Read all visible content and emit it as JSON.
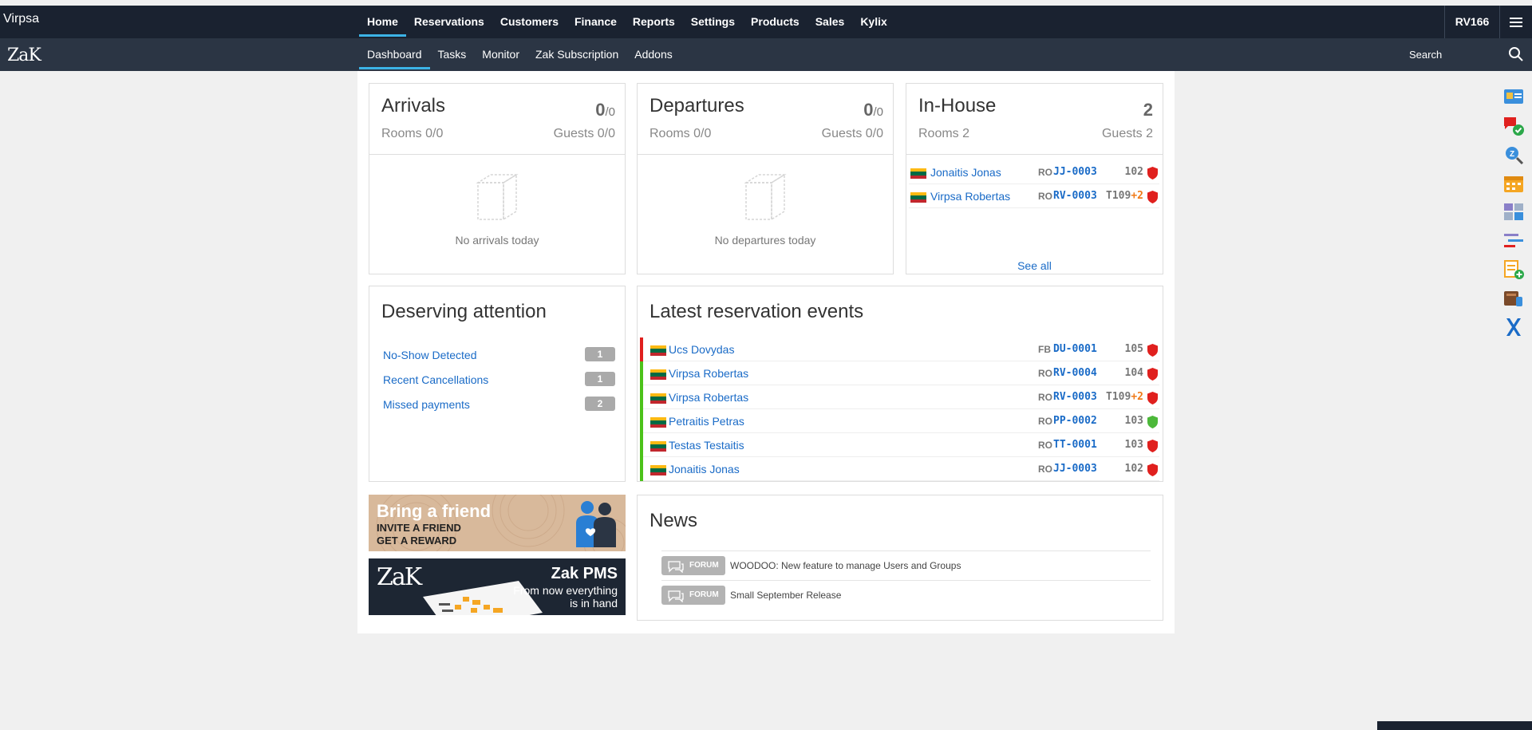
{
  "hotel_name": "Virpsa",
  "logo_text": "ZaK",
  "main_nav": [
    {
      "label": "Home",
      "active": true
    },
    {
      "label": "Reservations"
    },
    {
      "label": "Customers"
    },
    {
      "label": "Finance"
    },
    {
      "label": "Reports"
    },
    {
      "label": "Settings"
    },
    {
      "label": "Products"
    },
    {
      "label": "Sales"
    },
    {
      "label": "Kylix"
    }
  ],
  "sub_nav": [
    {
      "label": "Dashboard",
      "active": true
    },
    {
      "label": "Tasks"
    },
    {
      "label": "Monitor"
    },
    {
      "label": "Zak Subscription"
    },
    {
      "label": "Addons"
    }
  ],
  "user_code": "RV166",
  "search_label": "Search",
  "arrivals": {
    "title": "Arrivals",
    "count": "0",
    "total": "/0",
    "rooms": "Rooms 0/0",
    "guests": "Guests 0/0",
    "empty": "No arrivals today"
  },
  "departures": {
    "title": "Departures",
    "count": "0",
    "total": "/0",
    "rooms": "Rooms 0/0",
    "guests": "Guests 0/0",
    "empty": "No departures today"
  },
  "inhouse": {
    "title": "In-House",
    "count": "2",
    "rooms": "Rooms 2",
    "guests": "Guests 2",
    "rows": [
      {
        "name": "Jonaitis Jonas",
        "plan": "RO",
        "res": "JJ-0003",
        "room": "102",
        "extra": "",
        "shield": "#e0201e"
      },
      {
        "name": "Virpsa Robertas",
        "plan": "RO",
        "res": "RV-0003",
        "room": "T109",
        "extra": "+2",
        "shield": "#e0201e"
      }
    ],
    "see_all": "See all"
  },
  "attention": {
    "title": "Deserving attention",
    "items": [
      {
        "label": "No-Show Detected",
        "count": "1"
      },
      {
        "label": "Recent Cancellations",
        "count": "1"
      },
      {
        "label": "Missed payments",
        "count": "2"
      }
    ]
  },
  "events": {
    "title": "Latest reservation events",
    "rows": [
      {
        "name": "Ucs Dovydas",
        "plan": "FB",
        "res": "DU-0001",
        "room": "105",
        "extra": "",
        "bar": "#e0201e",
        "shield": "#e0201e"
      },
      {
        "name": "Virpsa Robertas",
        "plan": "RO",
        "res": "RV-0004",
        "room": "104",
        "extra": "",
        "bar": "#4cc21a",
        "shield": "#e0201e"
      },
      {
        "name": "Virpsa Robertas",
        "plan": "RO",
        "res": "RV-0003",
        "room": "T109",
        "extra": "+2",
        "bar": "#4cc21a",
        "shield": "#e0201e"
      },
      {
        "name": "Petraitis Petras",
        "plan": "RO",
        "res": "PP-0002",
        "room": "103",
        "extra": "",
        "bar": "#4cc21a",
        "shield": "#4cb83a"
      },
      {
        "name": "Testas Testaitis",
        "plan": "RO",
        "res": "TT-0001",
        "room": "103",
        "extra": "",
        "bar": "#4cc21a",
        "shield": "#e0201e"
      },
      {
        "name": "Jonaitis Jonas",
        "plan": "RO",
        "res": "JJ-0003",
        "room": "102",
        "extra": "",
        "bar": "#4cc21a",
        "shield": "#e0201e"
      }
    ]
  },
  "promo_friend": {
    "title": "Bring a friend",
    "line1": "INVITE A FRIEND",
    "line2": "GET A REWARD"
  },
  "promo_pms": {
    "logo": "ZaK",
    "title": "Zak PMS",
    "line1": "From now everything",
    "line2": "is in hand"
  },
  "news": {
    "title": "News",
    "items": [
      {
        "tag": "FORUM",
        "text": "WOODOO: New feature to manage Users and Groups"
      },
      {
        "tag": "FORUM",
        "text": "Small September Release"
      }
    ]
  },
  "colors": {
    "accent": "#3cb3e6",
    "link": "#1a6bc7",
    "nav_bg": "#1a2230",
    "subnav_bg": "#2b3544"
  }
}
